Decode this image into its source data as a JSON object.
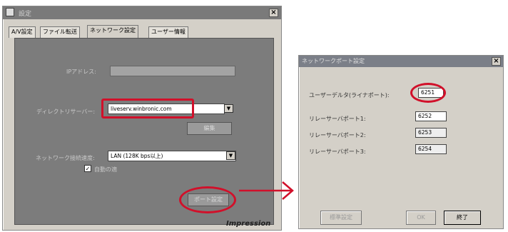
{
  "settings_dialog": {
    "title": "設定",
    "close_glyph": "×",
    "tabs": [
      {
        "label": "A/V設定"
      },
      {
        "label": "ファイル転送"
      },
      {
        "label": "ネットワーク設定"
      },
      {
        "label": "ユーザー情報"
      }
    ],
    "ip_address": {
      "label": "IPアドレス:",
      "value": ""
    },
    "directory_server": {
      "label": "ディレクトリサーバー:",
      "value": "liveserv.winbronic.com"
    },
    "edit_button": "編集",
    "connection_speed": {
      "label": "ネットワーク接続速度:",
      "value": "LAN (128K bps以上)"
    },
    "auto_detect": {
      "label": "自動の適",
      "checked": true
    },
    "port_button": "ポート設定",
    "brand": "Impression"
  },
  "port_dialog": {
    "title": "ネットワークポート設定",
    "close_glyph": "×",
    "user_port": {
      "label": "ユーザーデルタ(ライナポート):",
      "value": "6251"
    },
    "relay_ports": [
      {
        "label": "リレーサーバポート1:",
        "value": "6252"
      },
      {
        "label": "リレーサーバポート2:",
        "value": "6253"
      },
      {
        "label": "リレーサーバポート3:",
        "value": "6254"
      }
    ],
    "buttons": {
      "default": "標準設定",
      "ok": "OK",
      "cancel": "終了"
    }
  },
  "colors": {
    "highlight": "#d1102a",
    "panel": "#7c7c7c",
    "dialog": "#d4d0c8"
  }
}
